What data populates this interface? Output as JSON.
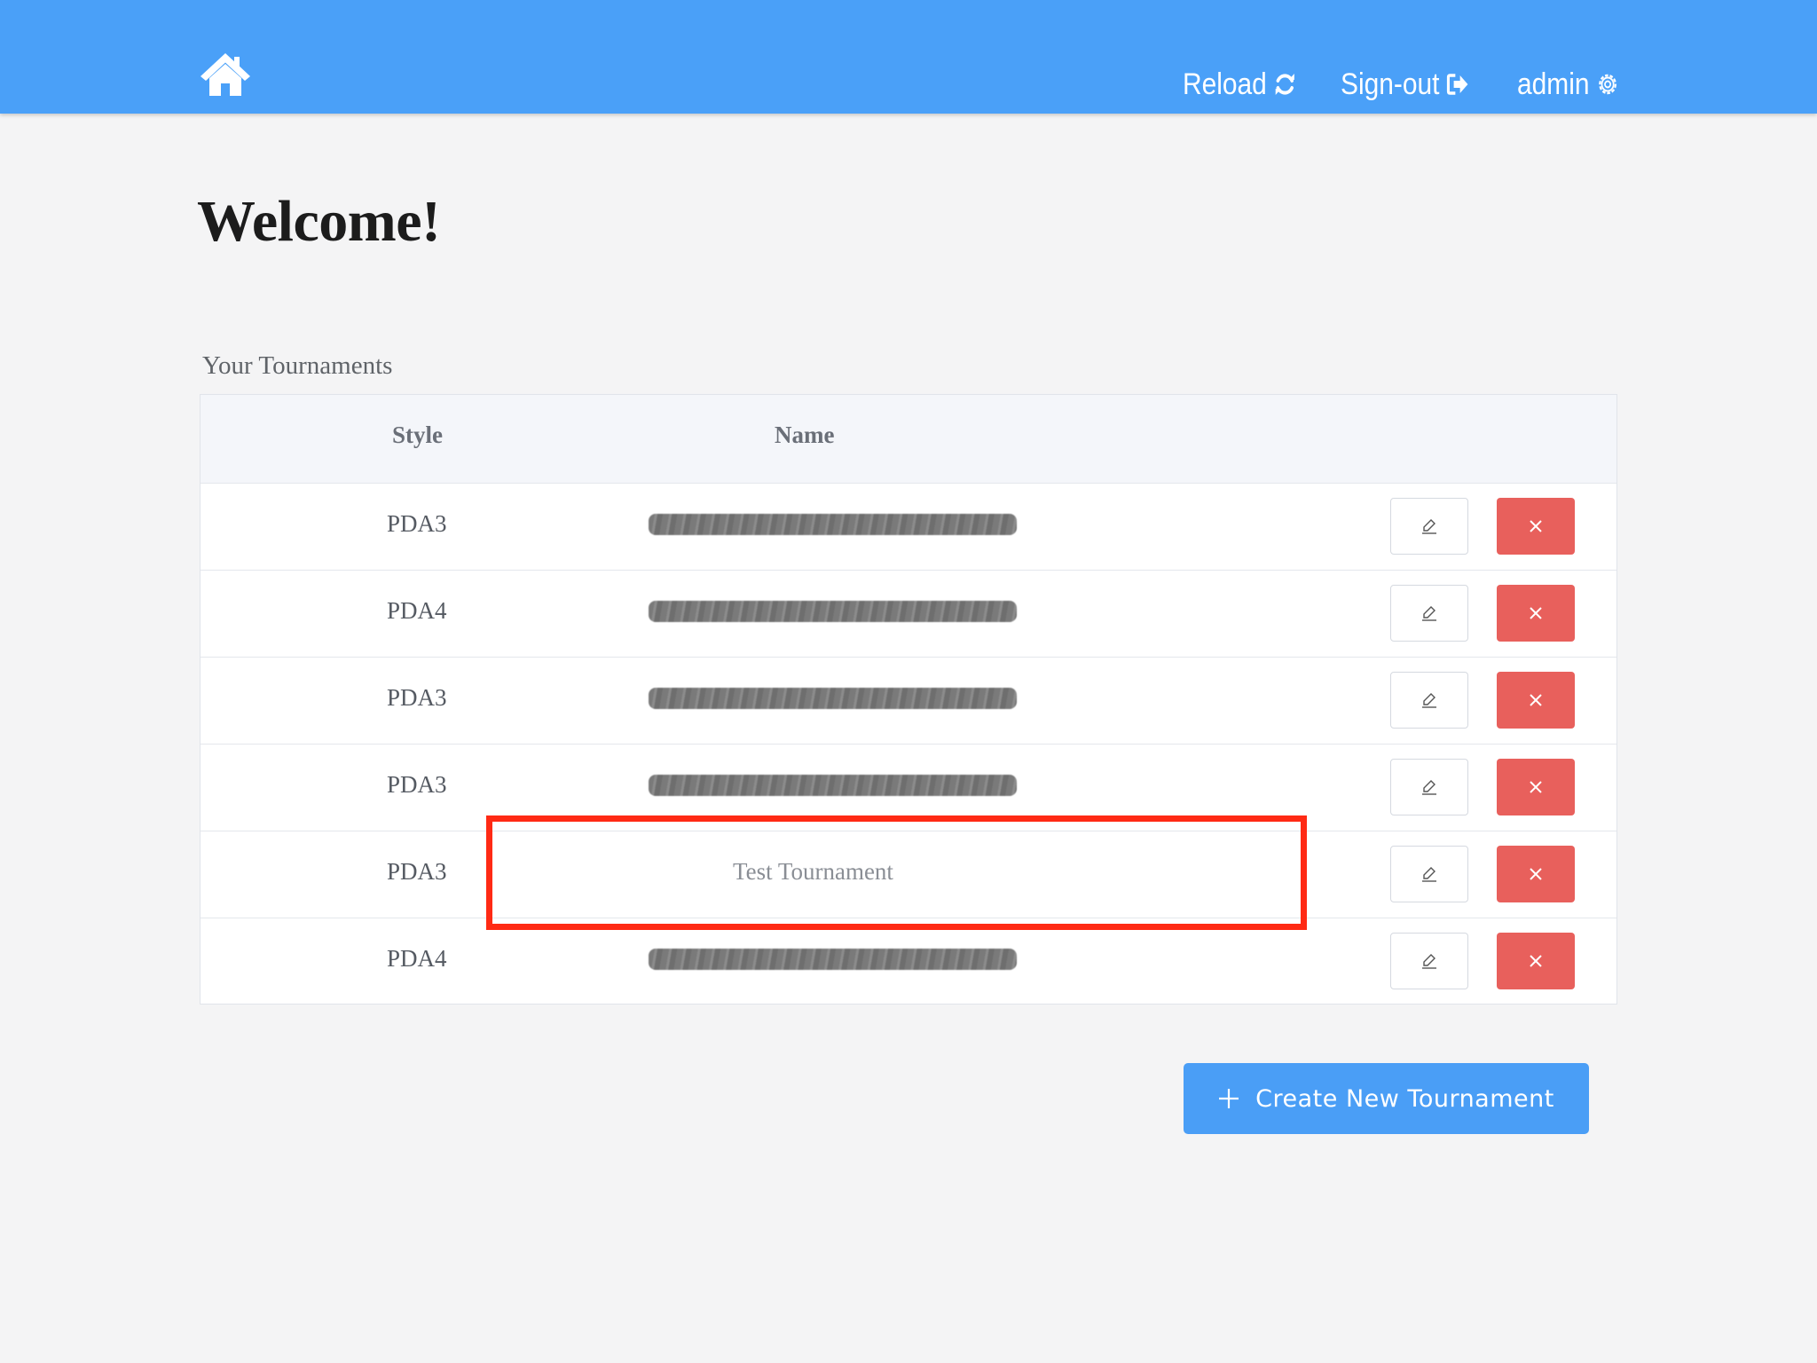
{
  "header": {
    "reload_label": "Reload",
    "signout_label": "Sign-out",
    "user_label": "admin"
  },
  "main": {
    "welcome": "Welcome!",
    "section_title": "Your Tournaments",
    "table": {
      "columns": [
        "Style",
        "Name"
      ],
      "rows": [
        {
          "style": "PDA3",
          "name": null,
          "name_redacted": true
        },
        {
          "style": "PDA4",
          "name": null,
          "name_redacted": true
        },
        {
          "style": "PDA3",
          "name": null,
          "name_redacted": true
        },
        {
          "style": "PDA3",
          "name": null,
          "name_redacted": true
        },
        {
          "style": "PDA3",
          "name": "Test Tournament",
          "name_redacted": false,
          "highlighted": true
        },
        {
          "style": "PDA4",
          "name": null,
          "name_redacted": true
        }
      ]
    },
    "create_button_label": "Create New Tournament"
  },
  "colors": {
    "header_bg": "#4aa0f8",
    "delete_button": "#e8605c",
    "create_button": "#4a9ef6",
    "highlight": "#ff2a14"
  },
  "icons": {
    "home": "home-icon",
    "reload": "reload-icon",
    "signout": "sign-out-icon",
    "settings": "gear-icon",
    "edit": "pencil-icon",
    "delete": "close-icon",
    "create": "plus-icon"
  }
}
